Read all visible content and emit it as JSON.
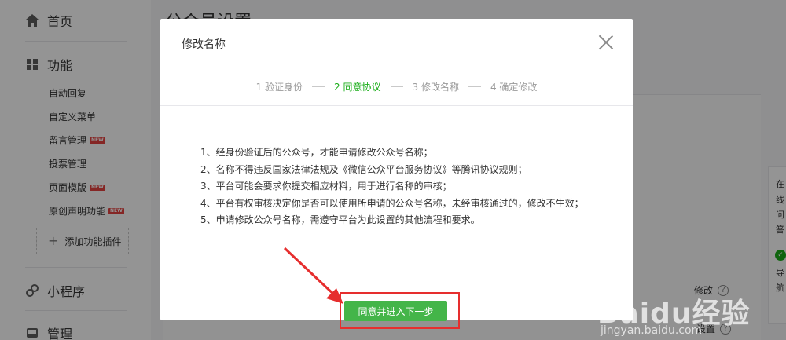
{
  "sidebar": {
    "home": "首页",
    "features": "功能",
    "sub_items": [
      {
        "label": "自动回复",
        "badge": ""
      },
      {
        "label": "自定义菜单",
        "badge": ""
      },
      {
        "label": "留言管理",
        "badge": "NEW"
      },
      {
        "label": "投票管理",
        "badge": ""
      },
      {
        "label": "页面模版",
        "badge": "NEW"
      },
      {
        "label": "原创声明功能",
        "badge": "NEW"
      }
    ],
    "add_plugin": "添加功能插件",
    "mini_program": "小程序",
    "manage": "管理"
  },
  "main": {
    "title": "公众号设置",
    "modify_link": "修改",
    "settings_link": "设置"
  },
  "right_panel": {
    "lines": [
      "在",
      "线",
      "问",
      "答"
    ],
    "lines2": [
      "导",
      "航"
    ]
  },
  "dialog": {
    "title": "修改名称",
    "steps": [
      {
        "label": "1 验证身份",
        "active": false
      },
      {
        "label": "2 同意协议",
        "active": true
      },
      {
        "label": "3 修改名称",
        "active": false
      },
      {
        "label": "4 确定修改",
        "active": false
      }
    ],
    "terms": [
      "1、经身份验证后的公众号，才能申请修改公众号名称；",
      "2、名称不得违反国家法律法规及《微信公众平台服务协议》等腾讯协议规则；",
      "3、平台可能会要求你提交相应材料，用于进行名称的审核；",
      "4、平台有权审核决定你是否可以使用所申请的公众号名称，未经审核通过的，修改不生效；",
      "5、申请修改公众号名称，需遵守平台为此设置的其他流程和要求。"
    ],
    "agree_button": "同意并进入下一步"
  },
  "watermark": {
    "logo": "Baidu经验",
    "url": "jingyan.baidu.com"
  },
  "colors": {
    "accent_green": "#44b549",
    "active_step": "#1aad19",
    "annotation_red": "#e62e2e"
  }
}
